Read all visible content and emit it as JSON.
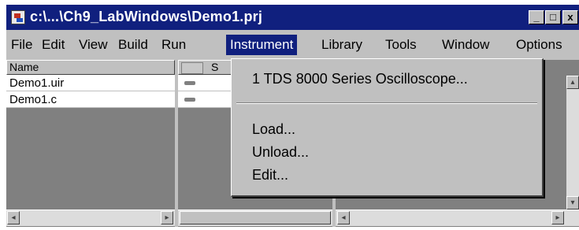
{
  "window": {
    "title": "c:\\...\\Ch9_LabWindows\\Demo1.prj",
    "controls": {
      "minimize": "_",
      "maximize": "□",
      "close": "x"
    }
  },
  "menubar": {
    "items": [
      "File",
      "Edit",
      "View",
      "Build",
      "Run",
      "Instrument",
      "Library",
      "Tools",
      "Window",
      "Options"
    ],
    "active": "Instrument"
  },
  "filelist": {
    "columns": [
      "Name",
      "S"
    ],
    "files": [
      "Demo1.uir",
      "Demo1.c"
    ]
  },
  "instrument_menu": {
    "loaded": "1 TDS 8000 Series Oscilloscope...",
    "actions": [
      "Load...",
      "Unload...",
      "Edit..."
    ]
  },
  "scrollbar_arrows": {
    "left": "◂",
    "right": "▸",
    "up": "▴",
    "down": "▾"
  }
}
